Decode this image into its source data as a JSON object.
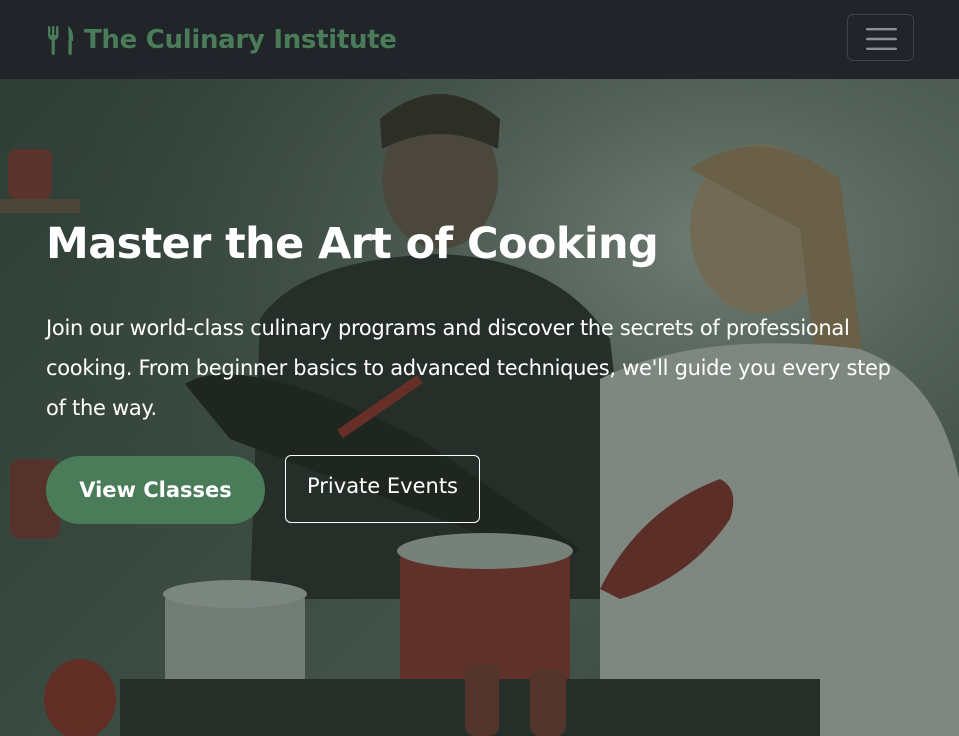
{
  "navbar": {
    "brand_icon": "utensils-icon",
    "brand_name": "The Culinary Institute",
    "menu_icon": "hamburger-menu-icon"
  },
  "hero": {
    "title": "Master the Art of Cooking",
    "description": "Join our world-class culinary programs and discover the secrets of professional cooking. From beginner basics to advanced techniques, we'll guide you every step of the way.",
    "primary_button": "View Classes",
    "secondary_button": "Private Events",
    "background_image": "two people cooking together in a kitchen with red pots and pans"
  },
  "colors": {
    "navbar_bg": "#212529",
    "brand": "#4a7c59",
    "primary_button_bg": "#4a7c59",
    "text": "#ffffff"
  }
}
